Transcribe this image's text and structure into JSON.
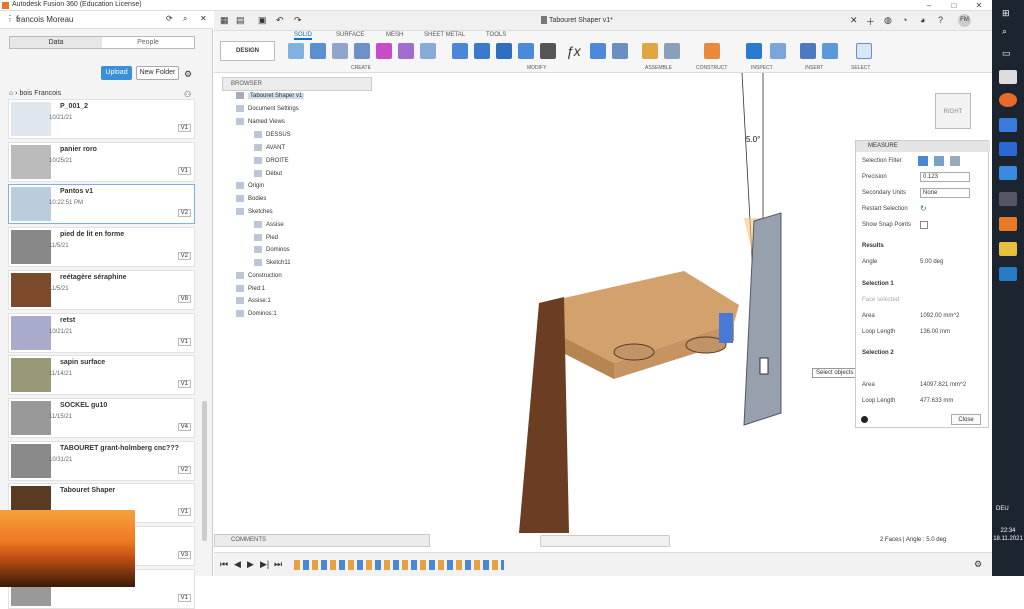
{
  "window": {
    "title": "Autodesk Fusion 360 (Education License)",
    "doc_title": "Tabouret Shaper v1*"
  },
  "user": {
    "name": "francois Moreau"
  },
  "data_panel": {
    "tabs": [
      "Data",
      "People"
    ],
    "upload": "Upload",
    "new_folder": "New Folder",
    "breadcrumb": "bois Francois",
    "files": [
      {
        "name": "P_001_2",
        "date": "10/21/21",
        "version": "V1"
      },
      {
        "name": "panier roro",
        "date": "10/25/21",
        "version": "V1"
      },
      {
        "name": "Pantos v1",
        "date": "10:22:51 PM",
        "version": "V2"
      },
      {
        "name": "pied de lit en forme",
        "date": "11/5/21",
        "version": "V2"
      },
      {
        "name": "reétagère séraphine",
        "date": "11/5/21",
        "version": "V8"
      },
      {
        "name": "retst",
        "date": "10/21/21",
        "version": "V1"
      },
      {
        "name": "sapin surface",
        "date": "11/14/21",
        "version": "V1"
      },
      {
        "name": "SOCKEL gu10",
        "date": "11/15/21",
        "version": "V4"
      },
      {
        "name": "TABOURET grant-holmberg cnc???",
        "date": "10/31/21",
        "version": "V2"
      },
      {
        "name": "Tabouret Shaper",
        "date": "",
        "version": "V1"
      },
      {
        "name": "",
        "date": "",
        "version": "V3"
      },
      {
        "name": "",
        "date": "",
        "version": "V1"
      }
    ]
  },
  "toolbar": {
    "design": "DESIGN",
    "tabs": [
      "SOLID",
      "SURFACE",
      "MESH",
      "SHEET METAL",
      "TOOLS"
    ],
    "groups": [
      "CREATE",
      "MODIFY",
      "ASSEMBLE",
      "CONSTRUCT",
      "INSPECT",
      "INSERT",
      "SELECT"
    ]
  },
  "browser": {
    "title": "BROWSER",
    "root": "Tabouret Shaper v1",
    "items": [
      "Document Settings",
      "Named Views",
      "DESSUS",
      "AVANT",
      "DROITE",
      "Début",
      "Origin",
      "Bodies",
      "Sketches",
      "Assise",
      "Pied",
      "Dominos",
      "Sketch11",
      "Construction",
      "Pied:1",
      "Assise:1",
      "Dominos:1"
    ]
  },
  "measure": {
    "title": "MEASURE",
    "selection_filter": "Selection Filter",
    "precision_label": "Precision",
    "precision": "0.123",
    "secondary_label": "Secondary Units",
    "secondary": "None",
    "restart": "Restart Selection",
    "snap": "Show Snap Points",
    "results": "Results",
    "angle_label": "Angle",
    "angle": "5.00 deg",
    "sel1": "Selection 1",
    "face_selected": "Face selected",
    "area1_label": "Area",
    "area1": "1092.00 mm^2",
    "loop1_label": "Loop Length",
    "loop1": "136.00 mm",
    "sel2": "Selection 2",
    "area2_label": "Area",
    "area2": "14097.821 mm^2",
    "loop2_label": "Loop Length",
    "loop2": "477.633 mm",
    "close": "Close"
  },
  "viewport": {
    "dim_label": "5.0°",
    "tooltip": "Select objects to measure.",
    "view_cube": "RIGHT",
    "status": "2 Faces | Angle : 5.0 deg"
  },
  "comments": "COMMENTS",
  "clock": {
    "time": "22:34",
    "date": "18.11.2021",
    "lang": "DEU"
  }
}
